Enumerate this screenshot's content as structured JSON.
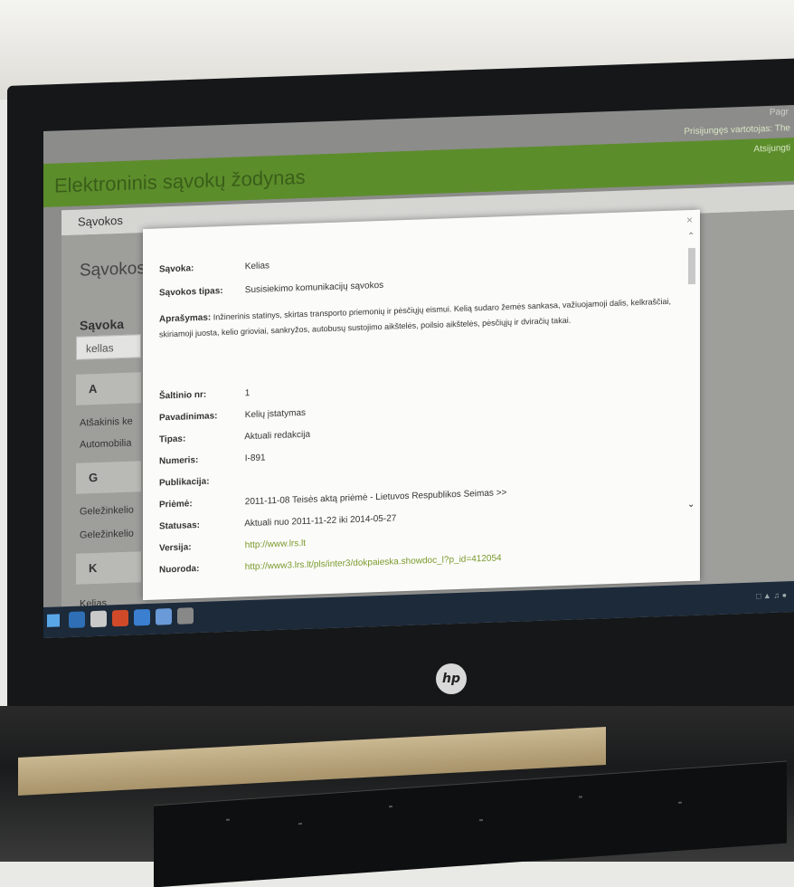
{
  "browser": {
    "sys_link": "Pagr"
  },
  "site": {
    "title": "Elektroninis sąvokų žodynas",
    "login_line1": "Prisijungęs vartotojas: The",
    "login_line2": "Atsijungti"
  },
  "nav": {
    "savokos": "Sąvokos"
  },
  "page": {
    "title": "Sąvokos",
    "search_label": "Sąvoka",
    "search_value": "kellas"
  },
  "list": [
    {
      "type": "letter",
      "text": "A"
    },
    {
      "type": "term",
      "text": "Atšakinis ke"
    },
    {
      "type": "term",
      "text": "Automobilia"
    },
    {
      "type": "letter",
      "text": "G"
    },
    {
      "type": "term",
      "text": "Geležinkelio"
    },
    {
      "type": "term",
      "text": "Geležinkelio"
    },
    {
      "type": "letter",
      "text": "K"
    },
    {
      "type": "term",
      "text": "Kelias"
    }
  ],
  "modal": {
    "close": "×",
    "savoka_label": "Sąvoka:",
    "savoka_value": "Kelias",
    "tipas_label": "Sąvokos tipas:",
    "tipas_value": "Susisiekimo komunikacijų sąvokos",
    "aprasymas_label": "Aprašymas:",
    "aprasymas_value": "Inžinerinis statinys, skirtas transporto priemonių ir pėsčiųjų eismui. Kelią sudaro žemės sankasa, važiuojamoji dalis, kelkraščiai, skiriamoji juosta, kelio grioviai, sankryžos, autobusų sustojimo aikštelės, poilsio aikštelės, pėsčiųjų ir dviračių takai.",
    "fields": [
      {
        "label": "Šaltinio nr:",
        "value": "1",
        "link": false
      },
      {
        "label": "Pavadinimas:",
        "value": "Kelių įstatymas",
        "link": false
      },
      {
        "label": "Tipas:",
        "value": "Aktuali redakcija",
        "link": false
      },
      {
        "label": "Numeris:",
        "value": "I-891",
        "link": false
      },
      {
        "label": "Publikacija:",
        "value": "",
        "link": false
      },
      {
        "label": "Priėmė:",
        "value": "2011-11-08 Teisės aktą priėmė - Lietuvos Respublikos Seimas >>",
        "link": false
      },
      {
        "label": "Statusas:",
        "value": "Aktuali nuo 2011-11-22 iki 2014-05-27",
        "link": false
      },
      {
        "label": "Versija:",
        "value": "http://www.lrs.lt",
        "link": true
      },
      {
        "label": "Nuoroda:",
        "value": "http://www3.lrs.lt/pls/inter3/dokpaieska.showdoc_l?p_id=412054",
        "link": true
      }
    ]
  },
  "device": {
    "logo": "hp"
  },
  "colors": {
    "header_green": "#5c8d2b",
    "link_green": "#7a9a2a",
    "bezel": "#151719"
  }
}
